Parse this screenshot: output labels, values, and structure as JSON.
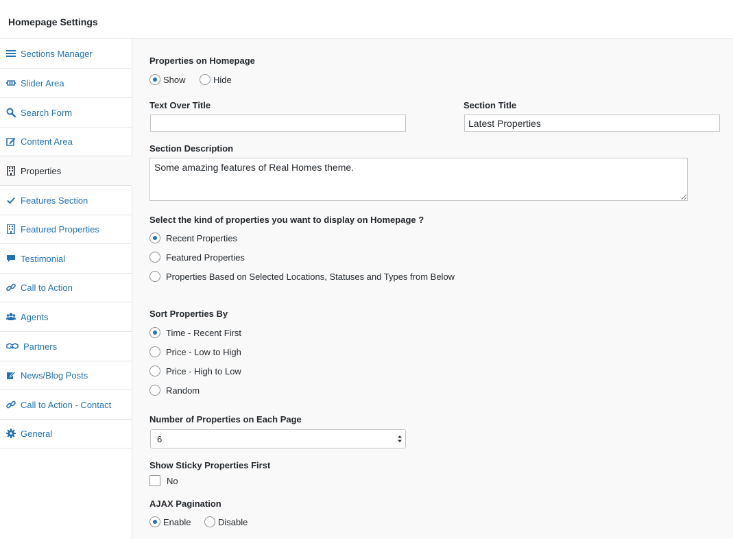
{
  "header": {
    "title": "Homepage Settings"
  },
  "sidebar": {
    "items": [
      {
        "label": "Sections Manager",
        "icon": "menu-icon",
        "active": false
      },
      {
        "label": "Slider Area",
        "icon": "slider-icon",
        "active": false
      },
      {
        "label": "Search Form",
        "icon": "search-icon",
        "active": false
      },
      {
        "label": "Content Area",
        "icon": "edit-icon",
        "active": false
      },
      {
        "label": "Properties",
        "icon": "building-icon",
        "active": true
      },
      {
        "label": "Features Section",
        "icon": "checkmark-icon",
        "active": false
      },
      {
        "label": "Featured Properties",
        "icon": "building-icon",
        "active": false
      },
      {
        "label": "Testimonial",
        "icon": "comment-icon",
        "active": false
      },
      {
        "label": "Call to Action",
        "icon": "link-icon",
        "active": false
      },
      {
        "label": "Agents",
        "icon": "users-icon",
        "active": false
      },
      {
        "label": "Partners",
        "icon": "handshake-icon",
        "active": false
      },
      {
        "label": "News/Blog Posts",
        "icon": "edit-note-icon",
        "active": false
      },
      {
        "label": "Call to Action - Contact",
        "icon": "link-icon",
        "active": false
      },
      {
        "label": "General",
        "icon": "gear-icon",
        "active": false
      }
    ]
  },
  "form": {
    "properties_on_homepage": {
      "label": "Properties on Homepage",
      "options": [
        "Show",
        "Hide"
      ],
      "selected": "Show"
    },
    "text_over_title": {
      "label": "Text Over Title",
      "value": ""
    },
    "section_title": {
      "label": "Section Title",
      "value": "Latest Properties"
    },
    "section_description": {
      "label": "Section Description",
      "value": "Some amazing features of Real Homes theme."
    },
    "kind": {
      "label": "Select the kind of properties you want to display on Homepage ?",
      "options": [
        "Recent Properties",
        "Featured Properties",
        "Properties Based on Selected Locations, Statuses and Types from Below"
      ],
      "selected": "Recent Properties"
    },
    "sort": {
      "label": "Sort Properties By",
      "options": [
        "Time - Recent First",
        "Price - Low to High",
        "Price - High to Low",
        "Random"
      ],
      "selected": "Time - Recent First"
    },
    "per_page": {
      "label": "Number of Properties on Each Page",
      "value": "6"
    },
    "sticky": {
      "label": "Show Sticky Properties First",
      "option": "No",
      "checked": false
    },
    "ajax": {
      "label": "AJAX Pagination",
      "options": [
        "Enable",
        "Disable"
      ],
      "selected": "Enable"
    }
  },
  "colors": {
    "link": "#2271b1",
    "text": "#23282d",
    "border": "#e2e4e7",
    "background": "#f9f9f9"
  }
}
